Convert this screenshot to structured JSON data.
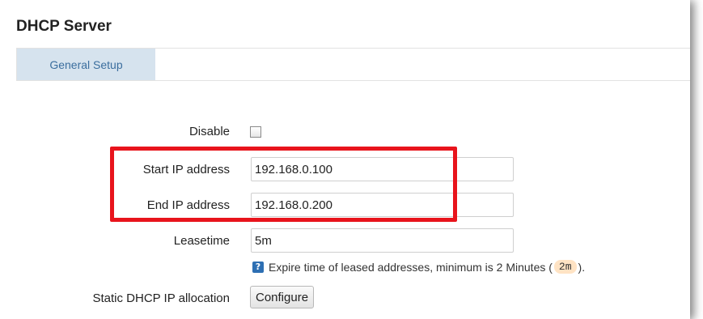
{
  "page": {
    "title": "DHCP Server"
  },
  "tabs": [
    {
      "label": "General Setup",
      "active": true
    }
  ],
  "form": {
    "disable": {
      "label": "Disable",
      "checked": false
    },
    "start_ip": {
      "label": "Start IP address",
      "value": "192.168.0.100"
    },
    "end_ip": {
      "label": "End IP address",
      "value": "192.168.0.200"
    },
    "leasetime": {
      "label": "Leasetime",
      "value": "5m",
      "help_icon": "question-icon",
      "help_text": "Expire time of leased addresses, minimum is 2 Minutes (",
      "help_code": "2m",
      "help_suffix": ")."
    },
    "static_alloc": {
      "label": "Static DHCP IP allocation",
      "button_label": "Configure"
    }
  },
  "colors": {
    "highlight": "#e8141c",
    "tab_active_bg": "#d6e3ee",
    "tab_active_text": "#3b6e9e",
    "help_icon": "#2d6fb3"
  }
}
